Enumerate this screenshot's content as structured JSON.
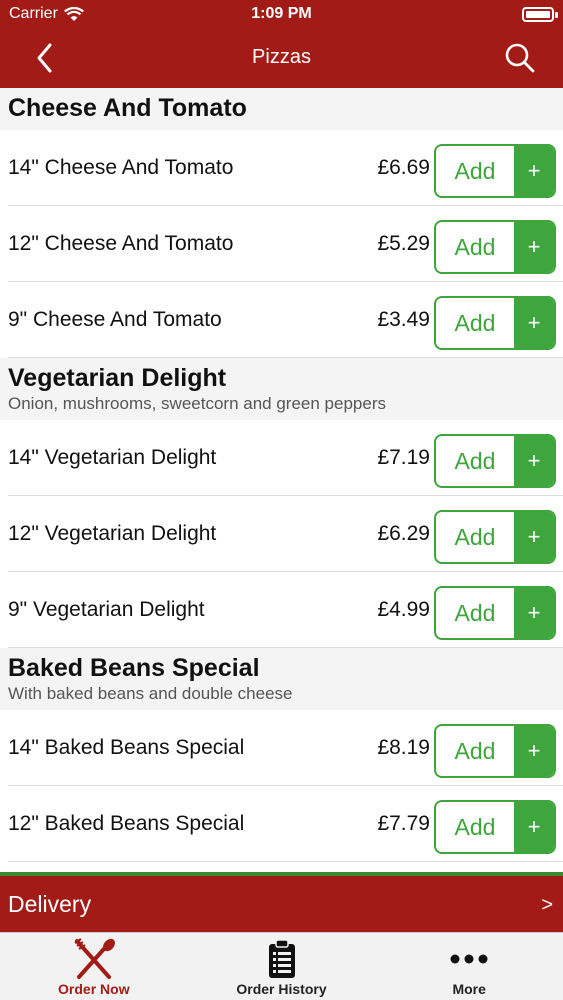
{
  "status_bar": {
    "carrier": "Carrier",
    "time": "1:09 PM"
  },
  "nav": {
    "title": "Pizzas"
  },
  "sections": [
    {
      "title": "Cheese And Tomato",
      "subtitle": "",
      "items": [
        {
          "name": "14\" Cheese And Tomato",
          "price": "£6.69"
        },
        {
          "name": "12\" Cheese And Tomato",
          "price": "£5.29"
        },
        {
          "name": "9\" Cheese And Tomato",
          "price": "£3.49"
        }
      ]
    },
    {
      "title": "Vegetarian Delight",
      "subtitle": "Onion, mushrooms, sweetcorn and green peppers",
      "items": [
        {
          "name": "14\" Vegetarian Delight",
          "price": "£7.19"
        },
        {
          "name": "12\" Vegetarian Delight",
          "price": "£6.29"
        },
        {
          "name": "9\" Vegetarian Delight",
          "price": "£4.99"
        }
      ]
    },
    {
      "title": "Baked Beans Special",
      "subtitle": "With baked beans and double cheese",
      "items": [
        {
          "name": "14\" Baked Beans Special",
          "price": "£8.19"
        },
        {
          "name": "12\" Baked Beans Special",
          "price": "£7.79"
        }
      ]
    }
  ],
  "add_button": {
    "label": "Add",
    "plus": "+"
  },
  "delivery": {
    "label": "Delivery",
    "arrow": ">"
  },
  "tabs": [
    {
      "label": "Order Now",
      "icon": "fork-knife-icon",
      "active": true
    },
    {
      "label": "Order History",
      "icon": "clipboard-list-icon",
      "active": false
    },
    {
      "label": "More",
      "icon": "more-dots-icon",
      "active": false
    }
  ],
  "colors": {
    "brand": "#a31b17",
    "accent": "#3ea63c"
  }
}
